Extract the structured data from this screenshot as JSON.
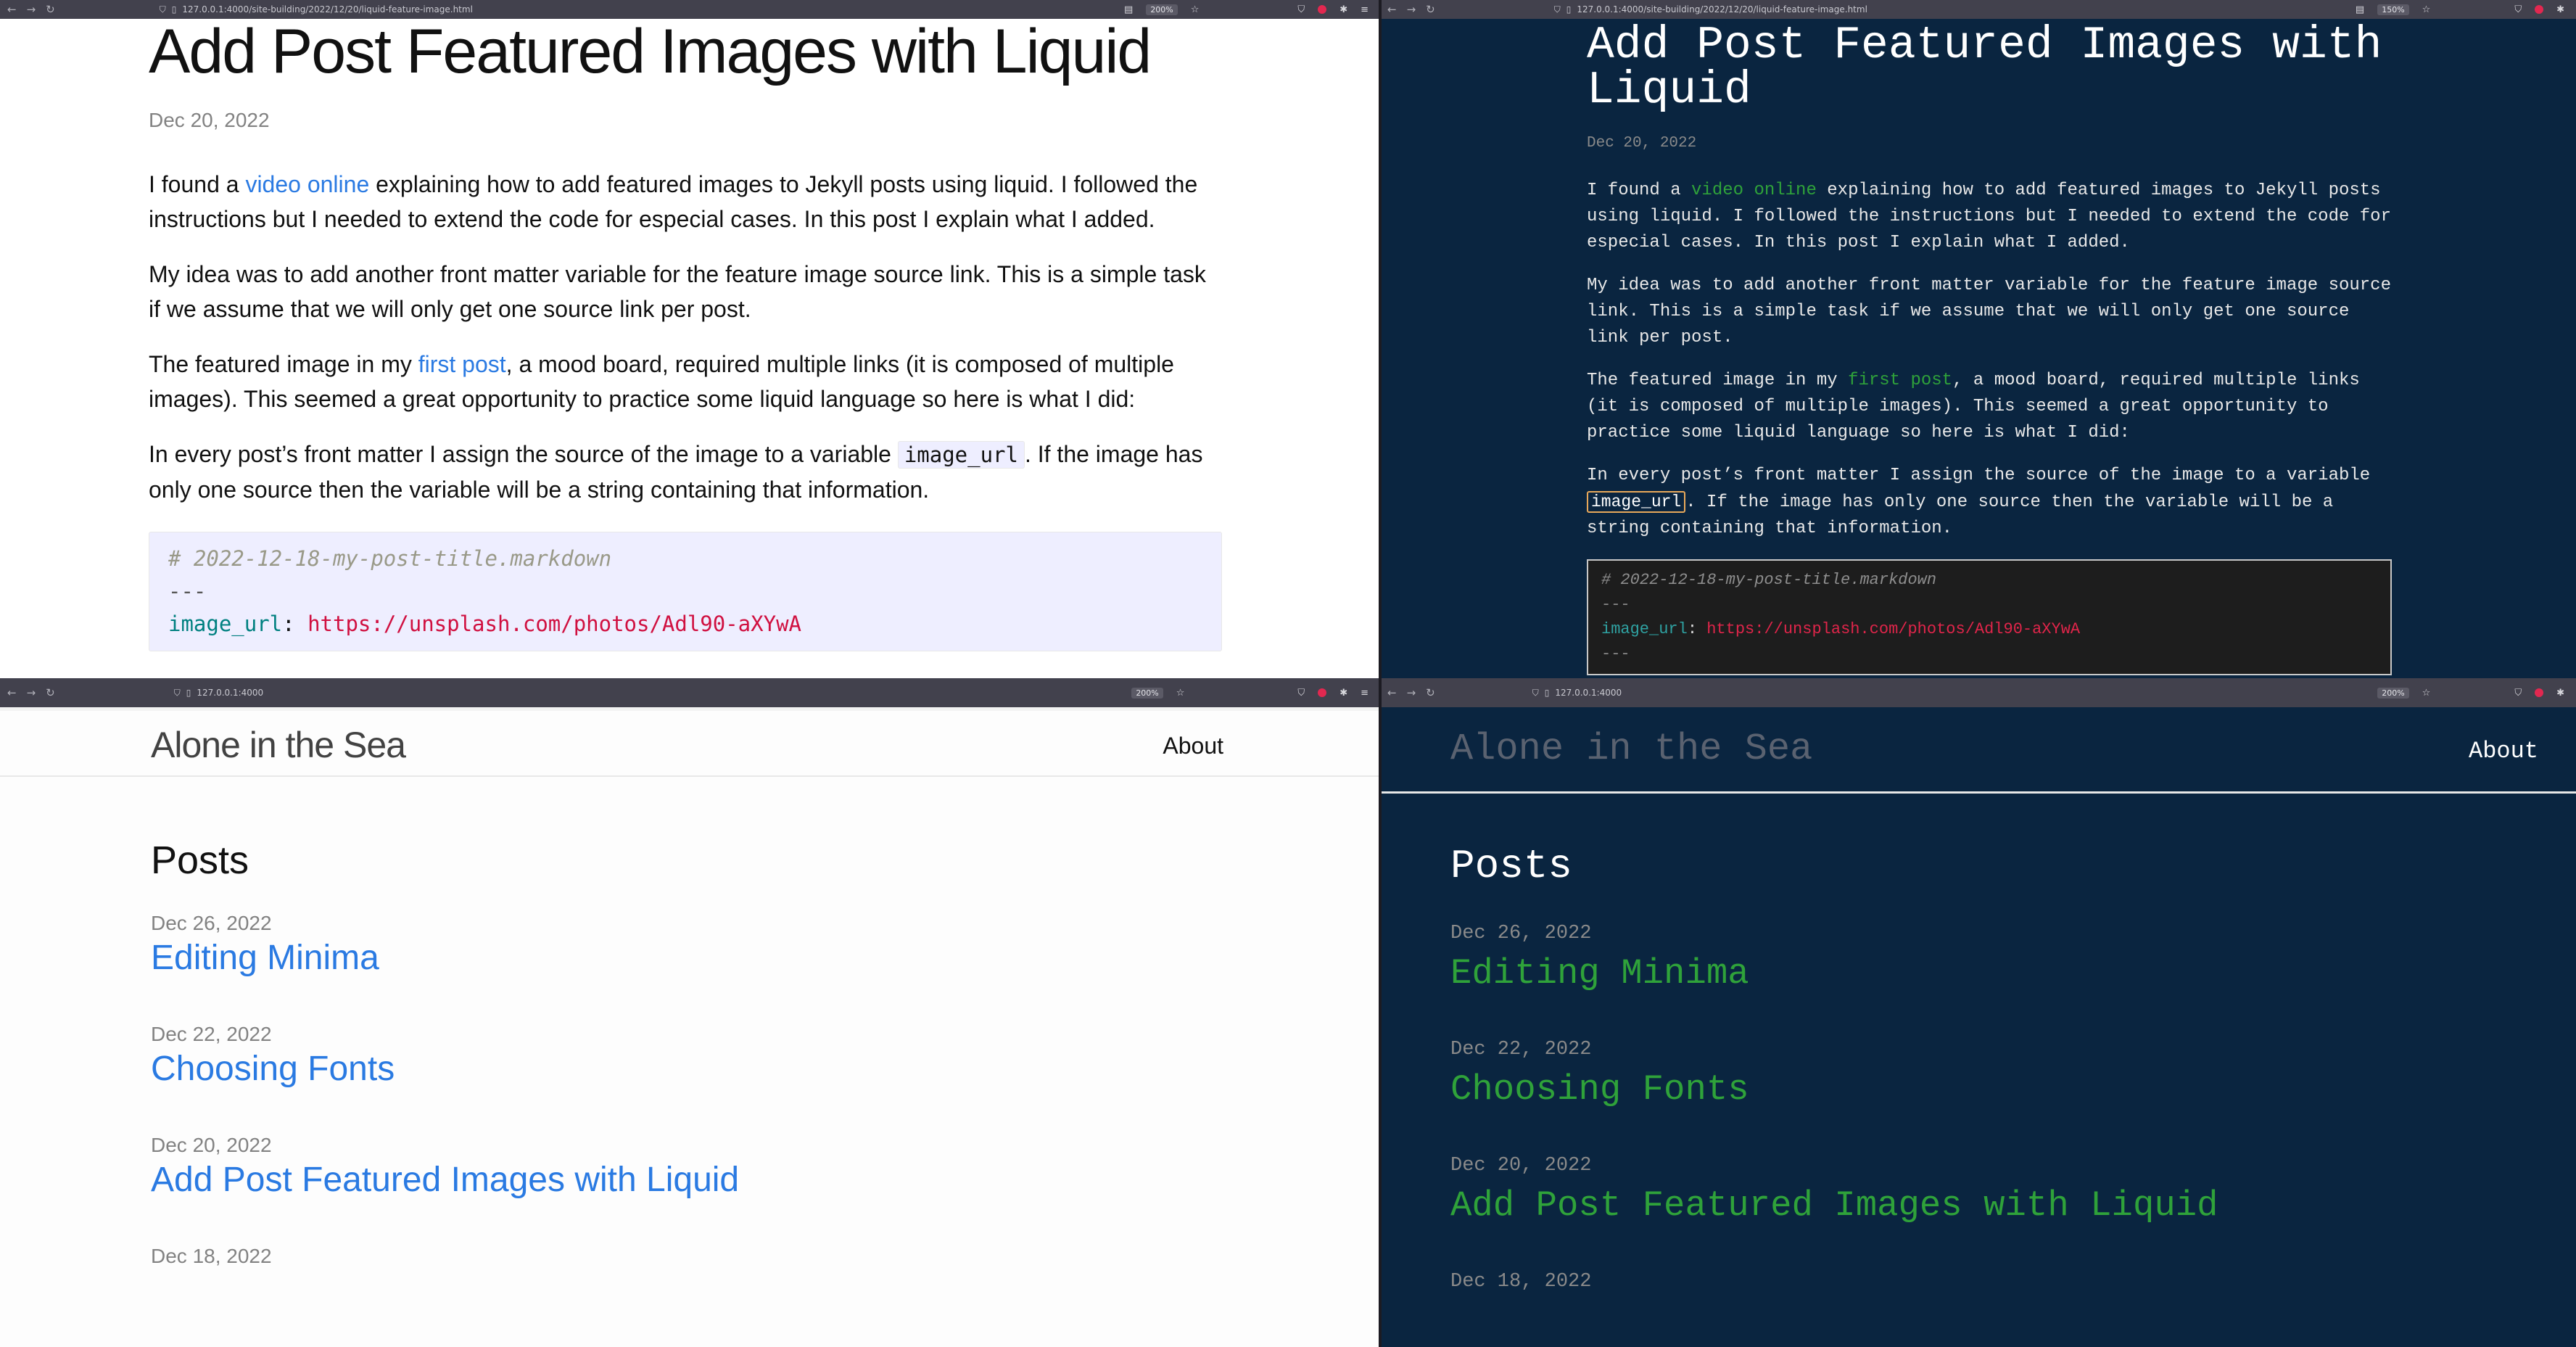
{
  "browser": {
    "url_post_left": "127.0.0.1:4000/site-building/2022/12/20/liquid-feature-image.html",
    "url_post_right": "127.0.0.1:4000/site-building/2022/12/20/liquid-feature-image.html",
    "url_home": "127.0.0.1:4000",
    "zoom_light": "200%",
    "zoom_dark_post": "150%",
    "zoom_dark_home": "200%"
  },
  "post": {
    "title": "Add Post Featured Images with Liquid",
    "date": "Dec 20, 2022",
    "p1_a": "I found a ",
    "p1_link": "video online",
    "p1_b": " explaining how to add featured images to Jekyll posts using liquid. I followed the instructions but I needed to extend the code for especial cases. In this post I explain what I added.",
    "p2": "My idea was to add another front matter variable for the feature image source link. This is a simple task if we assume that we will only get one source link per post.",
    "p3_a": "The featured image in my ",
    "p3_link": "first post",
    "p3_b": ", a mood board, required multiple links (it is composed of multiple images). This seemed a great opportunity to practice some liquid language so here is what I did:",
    "p4_a": "In every post’s front matter I assign the source of the image to a variable ",
    "p4_code": "image_url",
    "p4_b": ". If the image has only one source then the variable will be a string containing that information.",
    "code_comment": "# 2022-12-18-my-post-title.markdown",
    "code_dash": "---",
    "code_key": "image_url",
    "code_colon": ": ",
    "code_value": "https://unsplash.com/photos/Adl90-aXYwA",
    "code_dash_end": "---"
  },
  "home": {
    "site_title": "Alone in the Sea",
    "nav_about": "About",
    "heading": "Posts",
    "posts": [
      {
        "date": "Dec 26, 2022",
        "title": "Editing Minima"
      },
      {
        "date": "Dec 22, 2022",
        "title": "Choosing Fonts"
      },
      {
        "date": "Dec 20, 2022",
        "title": "Add Post Featured Images with Liquid"
      },
      {
        "date": "Dec 18, 2022",
        "title": ""
      }
    ]
  },
  "colors": {
    "light_link": "#2a7ae2",
    "dark_bg": "#0a2540",
    "dark_link": "#2fa23a",
    "code_value": "#d01040"
  }
}
